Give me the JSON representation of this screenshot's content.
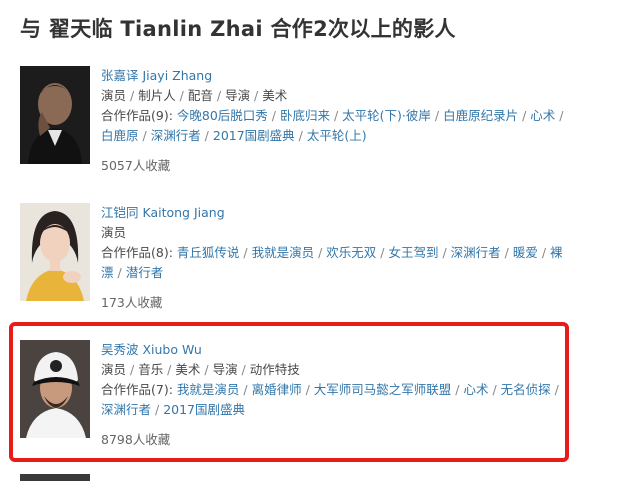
{
  "heading": "与 翟天临 Tianlin Zhai 合作2次以上的影人",
  "collaborators": [
    {
      "name": "张嘉译 Jiayi Zhang",
      "roles": [
        "演员",
        "制片人",
        "配音",
        "导演",
        "美术"
      ],
      "works_label": "合作作品(9):",
      "works": [
        "今晚80后脱口秀",
        "卧底归来",
        "太平轮(下)·彼岸",
        "白鹿原纪录片",
        "心术",
        "白鹿原",
        "深渊行者",
        "2017国剧盛典",
        "太平轮(上)"
      ],
      "favorites": "5057人收藏"
    },
    {
      "name": "江铠同 Kaitong Jiang",
      "roles": [
        "演员"
      ],
      "works_label": "合作作品(8):",
      "works": [
        "青丘狐传说",
        "我就是演员",
        "欢乐无双",
        "女王驾到",
        "深渊行者",
        "暖爱",
        "裸漂",
        "潜行者"
      ],
      "favorites": "173人收藏"
    },
    {
      "name": "吴秀波 Xiubo Wu",
      "roles": [
        "演员",
        "音乐",
        "美术",
        "导演",
        "动作特技"
      ],
      "works_label": "合作作品(7):",
      "works": [
        "我就是演员",
        "离婚律师",
        "大军师司马懿之军师联盟",
        "心术",
        "无名侦探",
        "深渊行者",
        "2017国剧盛典"
      ],
      "favorites": "8798人收藏"
    }
  ],
  "colors": {
    "link": "#3377aa",
    "text": "#494949",
    "highlight": "#e81b1b"
  }
}
